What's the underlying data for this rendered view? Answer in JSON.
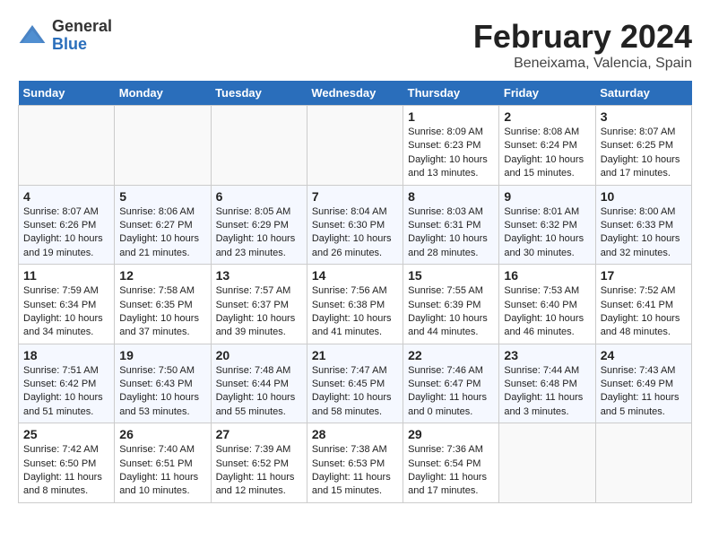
{
  "header": {
    "logo_general": "General",
    "logo_blue": "Blue",
    "month_title": "February 2024",
    "location": "Beneixama, Valencia, Spain"
  },
  "days_of_week": [
    "Sunday",
    "Monday",
    "Tuesday",
    "Wednesday",
    "Thursday",
    "Friday",
    "Saturday"
  ],
  "weeks": [
    [
      {
        "day": "",
        "empty": true
      },
      {
        "day": "",
        "empty": true
      },
      {
        "day": "",
        "empty": true
      },
      {
        "day": "",
        "empty": true
      },
      {
        "day": "1",
        "sunrise": "8:09 AM",
        "sunset": "6:23 PM",
        "daylight": "10 hours and 13 minutes."
      },
      {
        "day": "2",
        "sunrise": "8:08 AM",
        "sunset": "6:24 PM",
        "daylight": "10 hours and 15 minutes."
      },
      {
        "day": "3",
        "sunrise": "8:07 AM",
        "sunset": "6:25 PM",
        "daylight": "10 hours and 17 minutes."
      }
    ],
    [
      {
        "day": "4",
        "sunrise": "8:07 AM",
        "sunset": "6:26 PM",
        "daylight": "10 hours and 19 minutes."
      },
      {
        "day": "5",
        "sunrise": "8:06 AM",
        "sunset": "6:27 PM",
        "daylight": "10 hours and 21 minutes."
      },
      {
        "day": "6",
        "sunrise": "8:05 AM",
        "sunset": "6:29 PM",
        "daylight": "10 hours and 23 minutes."
      },
      {
        "day": "7",
        "sunrise": "8:04 AM",
        "sunset": "6:30 PM",
        "daylight": "10 hours and 26 minutes."
      },
      {
        "day": "8",
        "sunrise": "8:03 AM",
        "sunset": "6:31 PM",
        "daylight": "10 hours and 28 minutes."
      },
      {
        "day": "9",
        "sunrise": "8:01 AM",
        "sunset": "6:32 PM",
        "daylight": "10 hours and 30 minutes."
      },
      {
        "day": "10",
        "sunrise": "8:00 AM",
        "sunset": "6:33 PM",
        "daylight": "10 hours and 32 minutes."
      }
    ],
    [
      {
        "day": "11",
        "sunrise": "7:59 AM",
        "sunset": "6:34 PM",
        "daylight": "10 hours and 34 minutes."
      },
      {
        "day": "12",
        "sunrise": "7:58 AM",
        "sunset": "6:35 PM",
        "daylight": "10 hours and 37 minutes."
      },
      {
        "day": "13",
        "sunrise": "7:57 AM",
        "sunset": "6:37 PM",
        "daylight": "10 hours and 39 minutes."
      },
      {
        "day": "14",
        "sunrise": "7:56 AM",
        "sunset": "6:38 PM",
        "daylight": "10 hours and 41 minutes."
      },
      {
        "day": "15",
        "sunrise": "7:55 AM",
        "sunset": "6:39 PM",
        "daylight": "10 hours and 44 minutes."
      },
      {
        "day": "16",
        "sunrise": "7:53 AM",
        "sunset": "6:40 PM",
        "daylight": "10 hours and 46 minutes."
      },
      {
        "day": "17",
        "sunrise": "7:52 AM",
        "sunset": "6:41 PM",
        "daylight": "10 hours and 48 minutes."
      }
    ],
    [
      {
        "day": "18",
        "sunrise": "7:51 AM",
        "sunset": "6:42 PM",
        "daylight": "10 hours and 51 minutes."
      },
      {
        "day": "19",
        "sunrise": "7:50 AM",
        "sunset": "6:43 PM",
        "daylight": "10 hours and 53 minutes."
      },
      {
        "day": "20",
        "sunrise": "7:48 AM",
        "sunset": "6:44 PM",
        "daylight": "10 hours and 55 minutes."
      },
      {
        "day": "21",
        "sunrise": "7:47 AM",
        "sunset": "6:45 PM",
        "daylight": "10 hours and 58 minutes."
      },
      {
        "day": "22",
        "sunrise": "7:46 AM",
        "sunset": "6:47 PM",
        "daylight": "11 hours and 0 minutes."
      },
      {
        "day": "23",
        "sunrise": "7:44 AM",
        "sunset": "6:48 PM",
        "daylight": "11 hours and 3 minutes."
      },
      {
        "day": "24",
        "sunrise": "7:43 AM",
        "sunset": "6:49 PM",
        "daylight": "11 hours and 5 minutes."
      }
    ],
    [
      {
        "day": "25",
        "sunrise": "7:42 AM",
        "sunset": "6:50 PM",
        "daylight": "11 hours and 8 minutes."
      },
      {
        "day": "26",
        "sunrise": "7:40 AM",
        "sunset": "6:51 PM",
        "daylight": "11 hours and 10 minutes."
      },
      {
        "day": "27",
        "sunrise": "7:39 AM",
        "sunset": "6:52 PM",
        "daylight": "11 hours and 12 minutes."
      },
      {
        "day": "28",
        "sunrise": "7:38 AM",
        "sunset": "6:53 PM",
        "daylight": "11 hours and 15 minutes."
      },
      {
        "day": "29",
        "sunrise": "7:36 AM",
        "sunset": "6:54 PM",
        "daylight": "11 hours and 17 minutes."
      },
      {
        "day": "",
        "empty": true
      },
      {
        "day": "",
        "empty": true
      }
    ]
  ]
}
